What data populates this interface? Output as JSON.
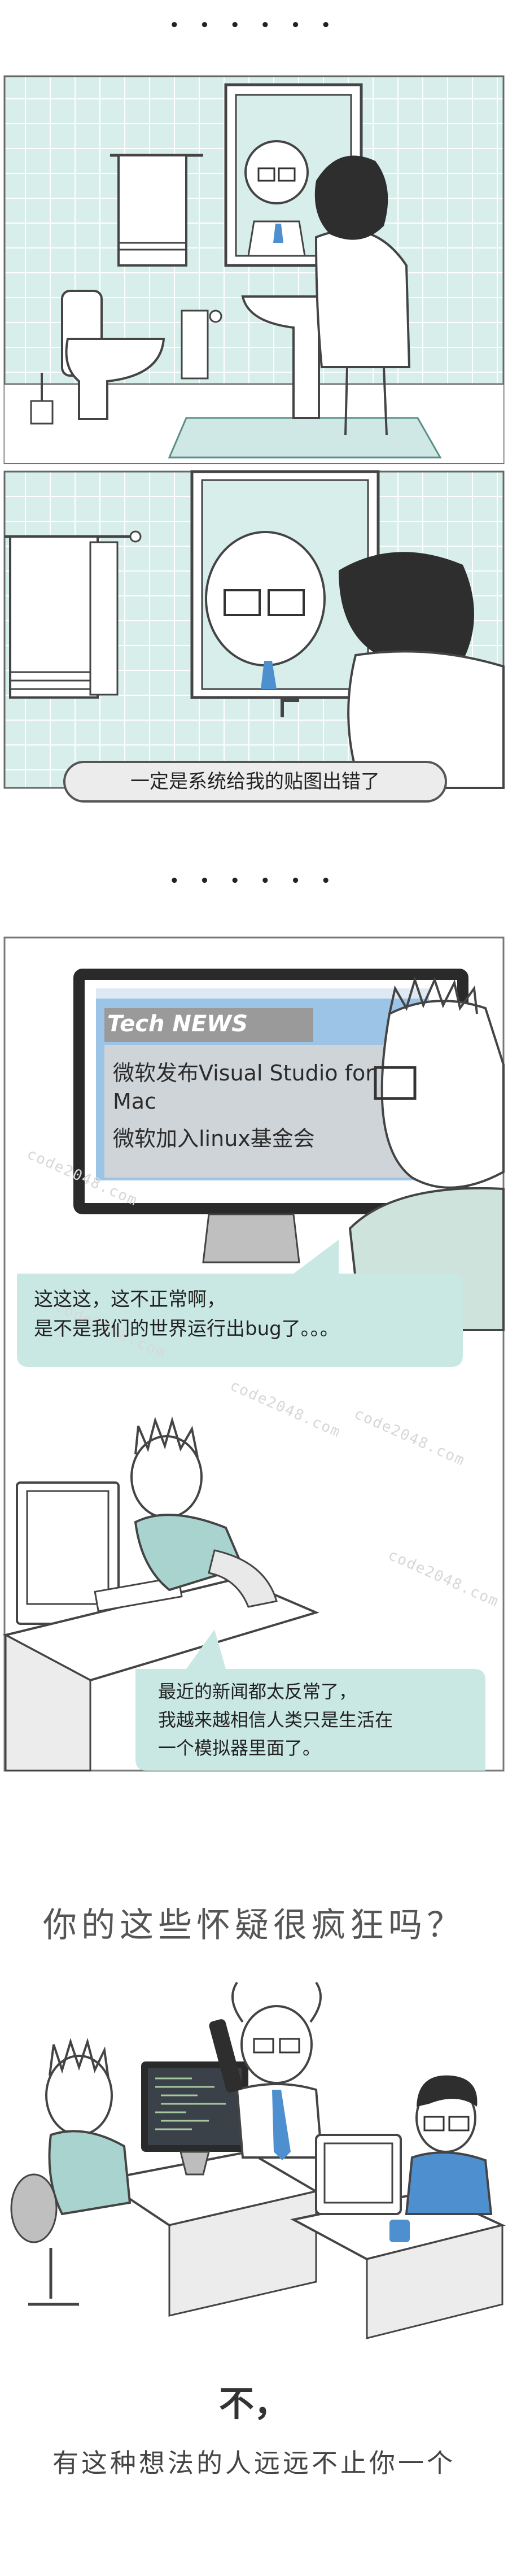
{
  "separators": [
    "• • • • • •",
    "• • • • • •"
  ],
  "panel1": {
    "caption": "一定是系统给我的贴图出错了"
  },
  "panel2": {
    "monitor": {
      "title": "Tech NEWS",
      "headline1": "微软发布Visual Studio for Mac",
      "headline2": "微软加入linux基金会"
    },
    "bubble1": [
      "这这这，这不正常啊，",
      "是不是我们的世界运行出bug了。。。"
    ],
    "bubble2": [
      "最近的新闻都太反常了，",
      "我越来越相信人类只是生活在",
      "一个模拟器里面了。"
    ],
    "watermark": "code2048.com"
  },
  "panel3": {
    "question": "你的这些怀疑很疯狂吗？",
    "answer": "不，",
    "conclusion": "有这种想法的人远远不止你一个"
  },
  "colors": {
    "tile": "#d7eeeb",
    "tile_line": "#ffffff",
    "teal_bubble": "#c9e8e4",
    "monitor_frame": "#2a2a2a",
    "screen_blue": "#9cc4e6",
    "outline": "#3a3a3a"
  }
}
